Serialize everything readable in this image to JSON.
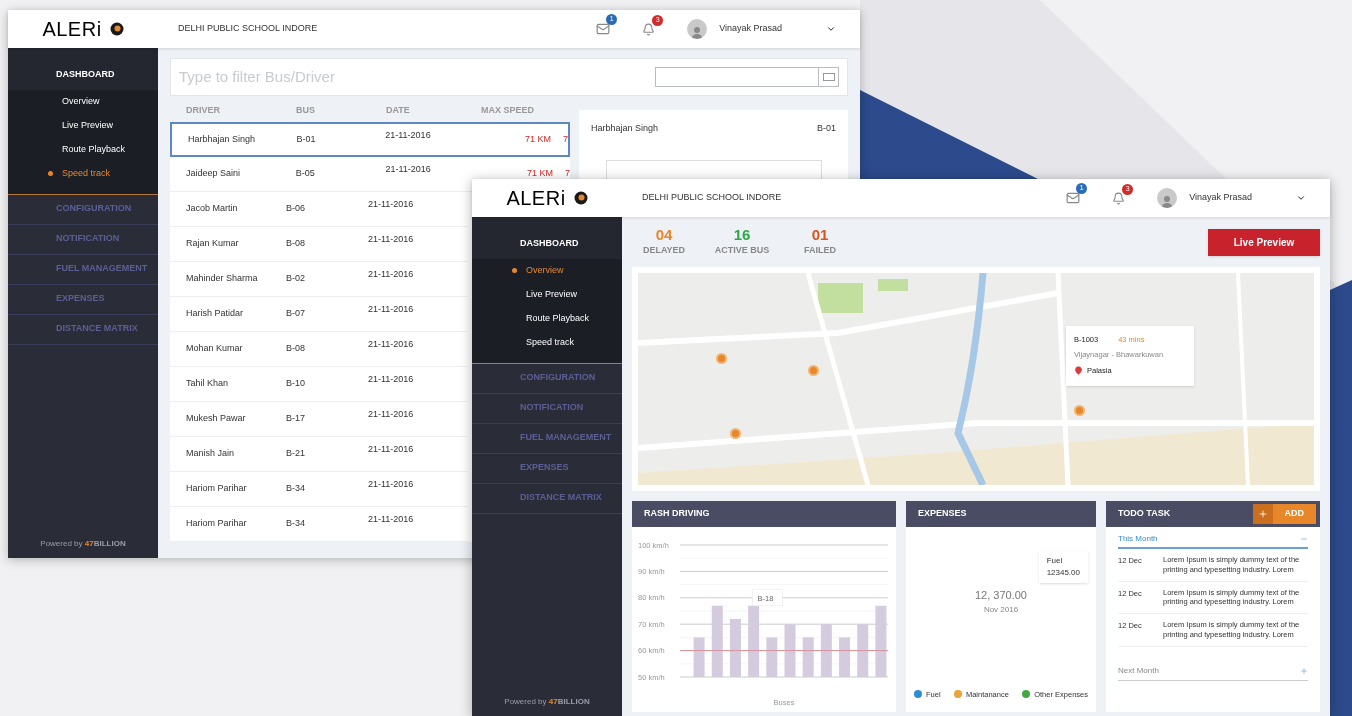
{
  "back_window": {
    "header": {
      "logo": "ALERi",
      "school": "DELHI PUBLIC SCHOOL INDORE",
      "mail_badge": "1",
      "bell_badge": "3",
      "user": "Vinayak Prasad"
    },
    "sidebar": {
      "sections": [
        {
          "label": "DASHBOARD",
          "expanded": true,
          "children": [
            {
              "label": "Overview",
              "selected": false
            },
            {
              "label": "Live Preview",
              "selected": false
            },
            {
              "label": "Route Playback",
              "selected": false
            },
            {
              "label": "Speed track",
              "selected": true
            }
          ]
        },
        {
          "label": "CONFIGURATION",
          "expanded": false
        },
        {
          "label": "NOTIFICATION",
          "expanded": false
        },
        {
          "label": "FUEL MANAGEMENT",
          "expanded": false
        },
        {
          "label": "EXPENSES",
          "expanded": false
        },
        {
          "label": "DISTANCE MATRIX",
          "expanded": false
        }
      ],
      "footer": {
        "text": "Powered by",
        "brand_number": "47",
        "brand_name": "BILLION"
      }
    },
    "filter": {
      "placeholder": "Type to filter Bus/Driver"
    },
    "table": {
      "columns": [
        "DRIVER",
        "BUS",
        "DATE",
        "MAX SPEED"
      ],
      "rows": [
        {
          "driver": "Harbhajan Singh",
          "bus": "B-01",
          "date": "21-11-2016",
          "max_speed": "71 KM",
          "column_5": "7",
          "selected": true
        },
        {
          "driver": "Jaideep Saini",
          "bus": "B-05",
          "date": "21-11-2016",
          "max_speed": "71 KM",
          "column_5": "7",
          "selected": false
        },
        {
          "driver": "Jacob Martin",
          "bus": "B-06",
          "date": "21-11-2016",
          "selected": false
        },
        {
          "driver": "Rajan Kumar",
          "bus": "B-08",
          "date": "21-11-2016",
          "selected": false
        },
        {
          "driver": "Mahinder Sharma",
          "bus": "B-02",
          "date": "21-11-2016",
          "selected": false
        },
        {
          "driver": "Harish Patidar",
          "bus": "B-07",
          "date": "21-11-2016",
          "selected": false
        },
        {
          "driver": "Mohan Kumar",
          "bus": "B-08",
          "date": "21-11-2016",
          "selected": false
        },
        {
          "driver": "Tahil Khan",
          "bus": "B-10",
          "date": "21-11-2016",
          "selected": false
        },
        {
          "driver": "Mukesh Pawar",
          "bus": "B-17",
          "date": "21-11-2016",
          "selected": false
        },
        {
          "driver": "Manish Jain",
          "bus": "B-21",
          "date": "21-11-2016",
          "selected": false
        },
        {
          "driver": "Hariom Parihar",
          "bus": "B-34",
          "date": "21-11-2016",
          "selected": false
        },
        {
          "driver": "Hariom Parihar",
          "bus": "B-34",
          "date": "21-11-2016",
          "selected": false
        }
      ]
    },
    "detail": {
      "driver": "Harbhajan Singh",
      "bus": "B-01"
    }
  },
  "front_window": {
    "header": {
      "logo": "ALERi",
      "school": "DELHI PUBLIC SCHOOL INDORE",
      "mail_badge": "1",
      "bell_badge": "3",
      "user": "Vinayak Prasad"
    },
    "sidebar": {
      "sections": [
        {
          "label": "DASHBOARD",
          "expanded": true,
          "children": [
            {
              "label": "Overview",
              "selected": true
            },
            {
              "label": "Live Preview",
              "selected": false
            },
            {
              "label": "Route Playback",
              "selected": false
            },
            {
              "label": "Speed track",
              "selected": false
            }
          ]
        },
        {
          "label": "CONFIGURATION",
          "expanded": false
        },
        {
          "label": "NOTIFICATION",
          "expanded": false
        },
        {
          "label": "FUEL MANAGEMENT",
          "expanded": false
        },
        {
          "label": "EXPENSES",
          "expanded": false
        },
        {
          "label": "DISTANCE MATRIX",
          "expanded": false
        }
      ],
      "footer": {
        "text": "Powered by",
        "brand_number": "47",
        "brand_name": "BILLION"
      }
    },
    "stats": [
      {
        "value": "04",
        "label": "DELAYED",
        "color": "#e8862a"
      },
      {
        "value": "16",
        "label": "ACTIVE BUS",
        "color": "#2fa64a"
      },
      {
        "value": "01",
        "label": "FAILED",
        "color": "#d9531e"
      }
    ],
    "live_preview_button": "Live Preview",
    "map_popup": {
      "bus": "B-1003",
      "eta": "43 mins",
      "route": "Vijaynagar - Bhawarkuwan",
      "stop": "Palasia"
    },
    "rash_driving": {
      "title": "RASH DRIVING",
      "chart_data": {
        "type": "bar",
        "xlabel": "Buses",
        "values": [
          65,
          77,
          72,
          77,
          65,
          70,
          65,
          70,
          65,
          70,
          77
        ],
        "ylim": [
          50,
          100
        ],
        "yticks": [
          {
            "value": 100,
            "label": "100 km/h"
          },
          {
            "value": 90,
            "label": "90 km/h"
          },
          {
            "value": 80,
            "label": "80 km/h"
          },
          {
            "value": 70,
            "label": "70 km/h"
          },
          {
            "value": 60,
            "label": "60 km/h"
          },
          {
            "value": 50,
            "label": "50 km/h"
          }
        ],
        "grid": true,
        "ref_lines": [
          {
            "axis": "y",
            "value": 60
          }
        ],
        "annotations": [
          "B-18"
        ]
      }
    },
    "expenses": {
      "title": "EXPENSES",
      "total": "12, 370.00",
      "period": "Nov 2016",
      "tooltip": {
        "label": "Fuel",
        "value": "12345.00"
      },
      "legend": [
        {
          "label": "Fuel",
          "color": "#2e8fd0"
        },
        {
          "label": "Maintanance",
          "color": "#eba23a"
        },
        {
          "label": "Other Expenses",
          "color": "#43a843"
        }
      ]
    },
    "todo": {
      "title": "TODO TASK",
      "add_button": "ADD",
      "groups": [
        {
          "label": "This Month",
          "expanded": true,
          "items": [
            {
              "date": "12 Dec",
              "text": "Lorem Ipsum is simply dummy text of the printing and typesetting industry. Lorem"
            },
            {
              "date": "12 Dec",
              "text": "Lorem Ipsum is simply dummy text of the printing and typesetting industry. Lorem"
            },
            {
              "date": "12 Dec",
              "text": "Lorem Ipsum is simply dummy text of the printing and typesetting industry. Lorem"
            }
          ]
        },
        {
          "label": "Next Month",
          "expanded": false
        }
      ]
    }
  }
}
